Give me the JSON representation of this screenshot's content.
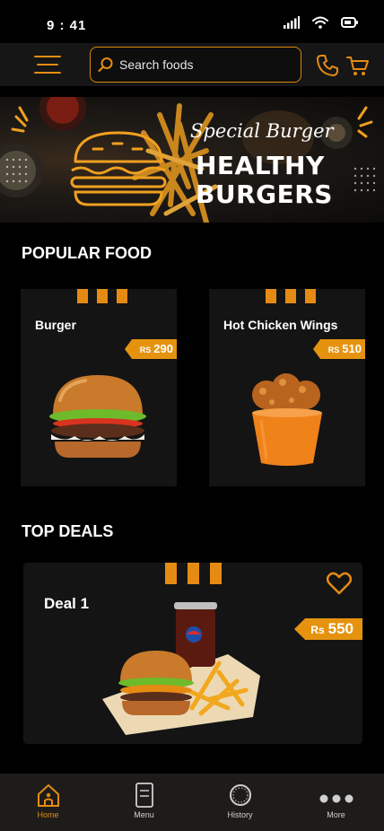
{
  "status": {
    "time": "9 : 41"
  },
  "search": {
    "placeholder": "Search foods"
  },
  "banner": {
    "script_text": "Special Burger",
    "title_line1": "HEALTHY",
    "title_line2": "BURGERS"
  },
  "popular": {
    "title": "POPULAR FOOD",
    "items": [
      {
        "name": "Burger",
        "currency": "RS",
        "price": "290"
      },
      {
        "name": "Hot Chicken Wings",
        "currency": "RS",
        "price": "510"
      }
    ]
  },
  "deals": {
    "title": "TOP DEALS",
    "items": [
      {
        "name": "Deal 1",
        "currency": "Rs",
        "price": "550"
      }
    ]
  },
  "nav": {
    "items": [
      {
        "label": "Home",
        "icon": "home-icon",
        "active": true
      },
      {
        "label": "Menu",
        "icon": "menu-book-icon",
        "active": false
      },
      {
        "label": "History",
        "icon": "clock-icon",
        "active": false
      },
      {
        "label": "More",
        "icon": "more-dots-icon",
        "active": false
      }
    ]
  },
  "colors": {
    "accent": "#e58b14",
    "background": "#000000",
    "card": "#141414",
    "nav": "#1e1c1b"
  }
}
